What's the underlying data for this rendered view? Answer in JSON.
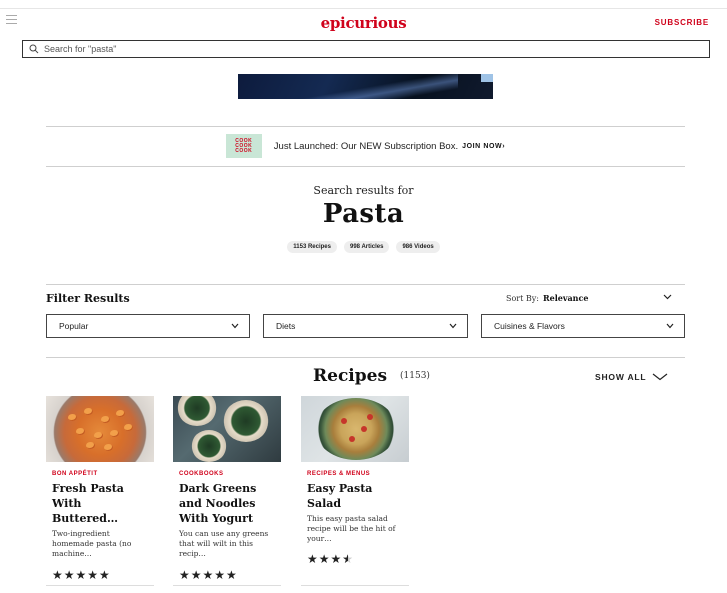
{
  "header": {
    "logo": "epicurious",
    "subscribe": "SUBSCRIBE"
  },
  "search": {
    "placeholder": "Search for \"pasta\""
  },
  "promo": {
    "text": "Just Launched: Our NEW Subscription Box.",
    "cta": "JOIN NOW›",
    "badge_lines": [
      "COOK",
      "COOK",
      "COOK"
    ]
  },
  "results": {
    "heading": "Search results for",
    "query": "Pasta",
    "pills": [
      "1153 Recipes",
      "998 Articles",
      "986 Videos"
    ]
  },
  "filters": {
    "title": "Filter Results",
    "sort_label": "Sort By:",
    "sort_value": "Relevance",
    "dropdowns": [
      "Popular",
      "Diets",
      "Cuisines & Flavors"
    ]
  },
  "recipes": {
    "heading": "Recipes",
    "count": "(1153)",
    "show_all": "SHOW ALL",
    "cards": [
      {
        "category": "BON APPÉTIT",
        "title": "Fresh Pasta With Buttered…",
        "desc": "Two-ingredient homemade pasta (no machine…",
        "stars": "★★★★★",
        "rating": 5
      },
      {
        "category": "COOKBOOKS",
        "title": "Dark Greens and Noodles With Yogurt",
        "desc": "You can use any greens that will wilt in this recip…",
        "stars": "★★★★★",
        "rating": 5
      },
      {
        "category": "RECIPES & MENUS",
        "title": "Easy Pasta Salad",
        "desc": "This easy pasta salad recipe will be the hit of your…",
        "stars": "★★★",
        "rating": 3.5
      }
    ]
  },
  "colors": {
    "accent": "#d0021b"
  }
}
